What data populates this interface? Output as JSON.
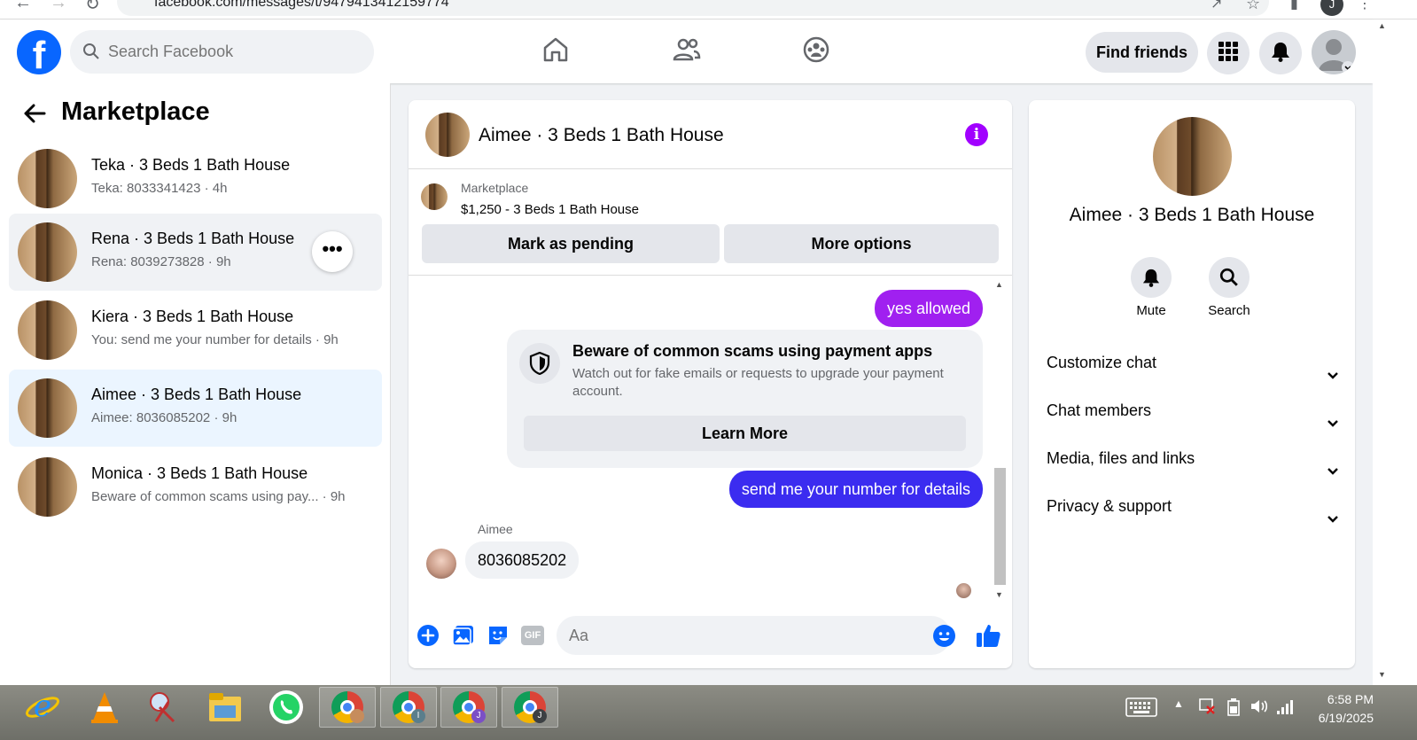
{
  "browser": {
    "url": "facebook.com/messages/t/9479413412159774",
    "profile_initial": "J"
  },
  "header": {
    "search_placeholder": "Search Facebook",
    "find_friends": "Find friends",
    "nav": [
      "home-icon",
      "friends-icon",
      "groups-icon"
    ],
    "accent": "#0866ff"
  },
  "left": {
    "title": "Marketplace",
    "conversations": [
      {
        "name": "Teka · 3 Beds 1 Bath House",
        "preview": "Teka: 8033341423 · 4h"
      },
      {
        "name": "Rena · 3 Beds 1 Bath House",
        "preview": "Rena: 8039273828 · 9h",
        "more": "•••"
      },
      {
        "name": "Kiera · 3 Beds 1 Bath House",
        "preview": "You: send me your number for details · 9h"
      },
      {
        "name": "Aimee · 3 Beds 1 Bath House",
        "preview": "Aimee: 8036085202 · 9h"
      },
      {
        "name": "Monica · 3 Beds 1 Bath House",
        "preview": "Beware of common scams using pay...  · 9h"
      }
    ]
  },
  "chat": {
    "title": "Aimee · 3 Beds 1 Bath House",
    "info": "i",
    "marketplace_label": "Marketplace",
    "listing": "$1,250 - 3 Beds 1 Bath House",
    "mark_pending": "Mark as pending",
    "more_options": "More options",
    "msg_out_1": "yes allowed",
    "scam_title": "Beware of common scams using payment apps",
    "scam_body": "Watch out for fake emails or requests to upgrade your payment account.",
    "learn_more": "Learn More",
    "msg_out_2": "send me your number for details",
    "sender": "Aimee",
    "msg_in": "8036085202",
    "composer_placeholder": "Aa",
    "gif_label": "GIF",
    "out_colors": {
      "purple": "#a020f0",
      "blue": "#3b2cf0"
    }
  },
  "right": {
    "name": "Aimee · 3 Beds 1 Bath House",
    "mute": "Mute",
    "search": "Search",
    "sections": [
      "Customize chat",
      "Chat members",
      "Media, files and links",
      "Privacy & support"
    ]
  },
  "taskbar": {
    "time": "6:58 PM",
    "date": "6/19/2025",
    "badges": [
      "",
      "I",
      "J",
      "J"
    ]
  }
}
